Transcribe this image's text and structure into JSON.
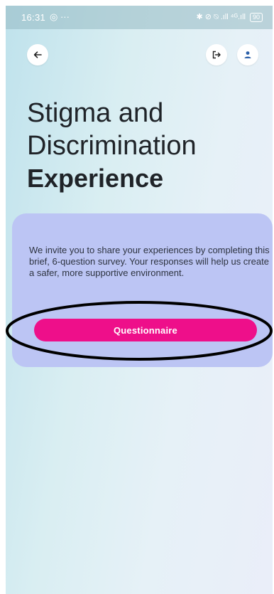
{
  "status_bar": {
    "time": "16:31",
    "left_icons": "◎ ···",
    "right_icons": "✱ ⊘ ⍉ .ıll ⁴ᴳ.ıll",
    "battery": "90"
  },
  "header": {
    "back_icon": "arrow-left-icon",
    "logout_icon": "logout-icon",
    "profile_icon": "person-icon"
  },
  "title": {
    "line1": "Stigma and",
    "line2": "Discrimination",
    "line3": "Experience"
  },
  "card": {
    "description": "We invite you to share your experiences by completing this brief, 6-question survey. Your responses will help us create a safer, more supportive environment.",
    "button_label": "Questionnaire"
  },
  "colors": {
    "accent": "#ee0f8a",
    "card_bg": "#bcc5f4",
    "title_text": "#1f2328"
  }
}
